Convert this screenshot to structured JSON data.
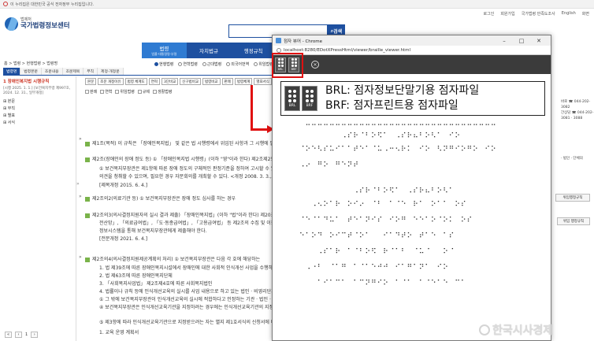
{
  "banner": {
    "text": "이 누리집은 대한민국 공식 전자정부 누리집입니다."
  },
  "util_links": [
    "로그인",
    "회원가입",
    "국가법령 만족도조사",
    "English",
    "화면"
  ],
  "logo": {
    "small": "법제처",
    "big": "국가법령정보센터"
  },
  "search": {
    "button": "검색"
  },
  "gnb": [
    {
      "label": "법령",
      "sub": "법률·대통령령·부령"
    },
    {
      "label": "자치법규",
      "sub": ""
    },
    {
      "label": "행정규칙",
      "sub": ""
    }
  ],
  "breadcrumb": "홈 > 법령 > 현행법령 > 법령명",
  "radios": [
    "현행법령",
    "연혁법령",
    "근대법령",
    "외국어번역",
    "위임법령"
  ],
  "subtabs": [
    "법령명",
    "법령본문",
    "조문내용",
    "조문제목",
    "부칙",
    "제정·개정문"
  ],
  "sidebar": {
    "title": "1 장애인복지법 시행규칙",
    "date": "[시행 2025. 1. 1.] [보건복지부령 제997호, 2024. 12. 31., 일부개정]",
    "nodes": [
      "본문",
      "부칙",
      "별표",
      "서식"
    ]
  },
  "pager": {
    "page": "1"
  },
  "toolbar": [
    "본문",
    "조문 개정이유",
    "법령 체계도",
    "연혁",
    "3단비교",
    "신구법비교",
    "법령비교",
    "판례",
    "법령체계",
    "별표서식",
    "법령다운",
    "점자",
    "점자파일"
  ],
  "options": {
    "items": [
      "판례",
      "연혁",
      "위임법령",
      "규제",
      "생활법령"
    ]
  },
  "articles": [
    "제1조(목적) 이 규칙은 「장애인복지법」 및 같은 법 시행령에서 위임된 사항과 그 시행에 필요한 사항을 규정함을 목적으로 한다.",
    "제2조(장애인의 장애 정도 등) ① 「장애인복지법 시행령」(이하 \"영\"이라 한다) 제2조제2항에 따른",
    "① 보건복지부장관은 제1항에 따른 장애 정도의 구체적인 판정기준을 정하여 고시할 수 있다.",
    "의견을 청취할 수 있으며, 필요한 경우 자문회의를 개최할 수 있다. <개정 2008. 3. 3., 2010.",
    "[제목개정 2015. 6. 4.]",
    "제2조의2(의료기관 등) ① 보건복지부장관은 장애 정도 심사를 하는 경우",
    "제2조의3(의사결정지원자의 실시 결과 제출) 「장애인복지법」(이하 \"법\"이라 한다) 제20조",
    "전산망」, 「의료급여법」, 「도·동종급여법」, 「고용급여법」 등 제2조의 수집 및 이용",
    "정보시스템을 통해 보건복지부장관에게 제출해야 한다.",
    "[전문개정 2021. 6. 4.]",
    "제2조의4(의사결정지원제공계획의 처리) ① 보건복지부장관은 다음 각 호에 해당하는",
    "1. 법 제39조에 따른 장애인복지시설에서 장애인에 대한 사회적 인식개선 사업을 수행하는 경우",
    "2. 법 제63조에 따른 장애인복지단체",
    "3. 「사회복지사업법」 제2조제4호에 따른 사회복지법인",
    "4. 법률이나 규칙 등에 인식개선교육의 실시를 사업 내용으로 하고 있는 법인 · 비영리단체",
    "① 그 밖에 보건복지부장관이 인식개선교육의 실시에 적합하다고 인정하는 기관 · 법인 · 시설 · 단체",
    "④ 보건복지부장관은 인식개선교육기관을 지정하려는 경우에는 인식개선교육기관의 지정계획을 수립하여",
    "⑤ 제3항에 따라 인식개선교육기관으로 지정받으려는 자는 별지 제1호서식의 신청서에 다음 각 호의 서류를",
    "1. 교육 운영 계획서"
  ],
  "right_info": [
    "바로 ☎ 044-202-3082",
    "간상담 ☎ 044-202-3081 · 3088"
  ],
  "right_extra": [
    "· 법인 · 단체의"
  ],
  "side_buttons": [
    "위임행정규칙",
    "위임 행정규칙"
  ],
  "popup": {
    "title": "점자 뷰어 - Chrome",
    "url": "localhost:8280/EDotXPressHtml/viewer/braille_viewer.html",
    "brl_label": "BRL",
    "brf_label": "BRF"
  },
  "callout": {
    "line1": "BRL: 점자정보단말기용 점자파일",
    "line2": "BRF: 점자프린트용 점자파일",
    "icon1": "BRL",
    "icon2": "BRF"
  },
  "braille_lines": [
    "⠀⠒⠒⠒⠒⠒⠒⠒⠒⠒⠒⠒⠒⠒⠒⠒⠒⠒⠒⠒⠒⠒⠒⠒⠒⠒⠒⠒⠒⠒⠒⠒⠒",
    "⠀⠀⠀⠀⠀⠀⠀⠠⠎⠗⠈⠃⠕⠫⠁⠀⠠⠎⠗⠦⠃⠕⠣⠁⠀⠊⠕",
    "⠈⠕⠑⠣⠎⠥⠊⠁⠁⠞⠑⠁⠈⠥⠠⠒⠢⠗⠅⠀⠊⠕⠀⠣⠝⠛⠊⠕⠛⠕⠀⠊⠕",
    "⠠⠔⠀⠛⠕⠀⠛⠑⠝⠞",
    "⠀⠀⠀⠀⠀⠀⠀⠀⠀⠠⠎⠗⠈⠃⠕⠫⠁⠀⠠⠎⠗⠦⠃⠕⠣⠁",
    "⠀⠀⠠⠢⠕⠁⠗⠀⠕⠊⠔⠀⠈⠃⠀⠁⠈⠑⠀⠗⠁⠀⠕⠁⠁⠀⠕⠎",
    "⠈⠑⠈⠁⠙⠥⠁⠀⠞⠑⠁⠝⠊⠎⠀⠊⠕⠛⠀⠑⠑⠁⠕⠈⠕⠅⠀⠕⠎",
    "⠑⠁⠕⠙⠀⠕⠊⠉⠞⠈⠕⠁⠀⠀⠊⠁⠙⠞⠕⠀⠞⠁⠑⠀⠁⠎",
    "⠀⠀⠀⠠⠎⠁⠗⠀⠁⠈⠃⠕⠫⠀⠗⠈⠁⠃⠀⠈⠥⠈⠀⠀⠕⠈",
    "⠀⠠⠐⠃⠀⠈⠁⠛⠀⠁⠈⠁⠑⠚⠚⠀⠊⠁⠛⠁⠝⠁⠀⠊⠕",
    "⠀⠀⠀⠁⠊⠁⠉⠁⠀⠁⠉⠝⠛⠊⠕⠀⠁⠈⠁⠀⠁⠈⠑⠁⠑⠀⠉⠁"
  ],
  "watermark": "한국시사경제"
}
